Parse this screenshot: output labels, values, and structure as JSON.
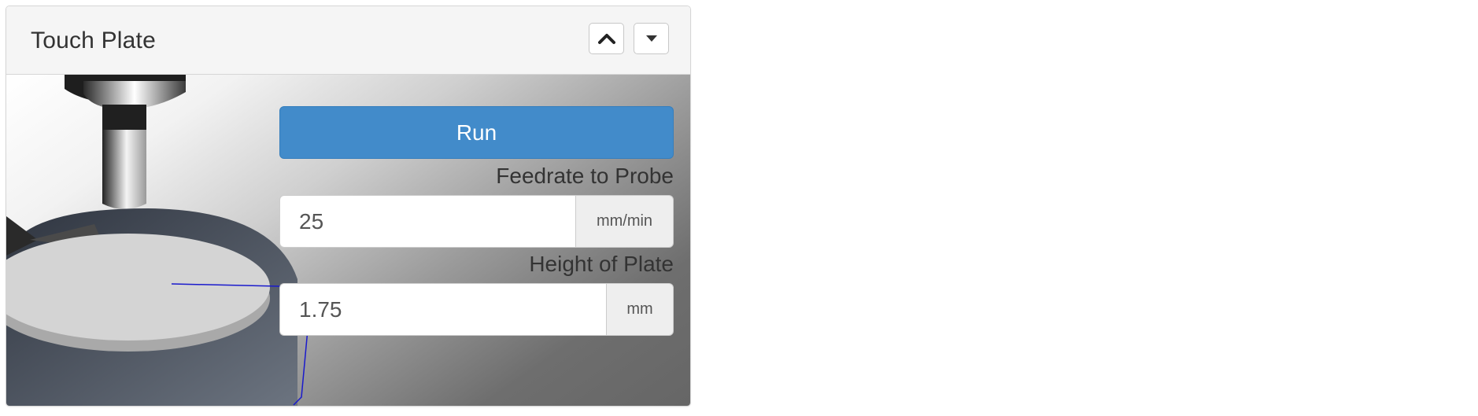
{
  "panel": {
    "title": "Touch Plate",
    "collapse_button": {
      "icon": "chevron-up-icon"
    },
    "menu_button": {
      "icon": "caret-down-icon"
    }
  },
  "touch_plate": {
    "run_label": "Run",
    "feedrate": {
      "label": "Feedrate to Probe",
      "value": "25",
      "unit": "mm/min"
    },
    "plate_height": {
      "label": "Height of Plate",
      "value": "1.75",
      "unit": "mm"
    }
  },
  "colors": {
    "primary": "#428bca",
    "guide_line": "#1a1acc"
  }
}
